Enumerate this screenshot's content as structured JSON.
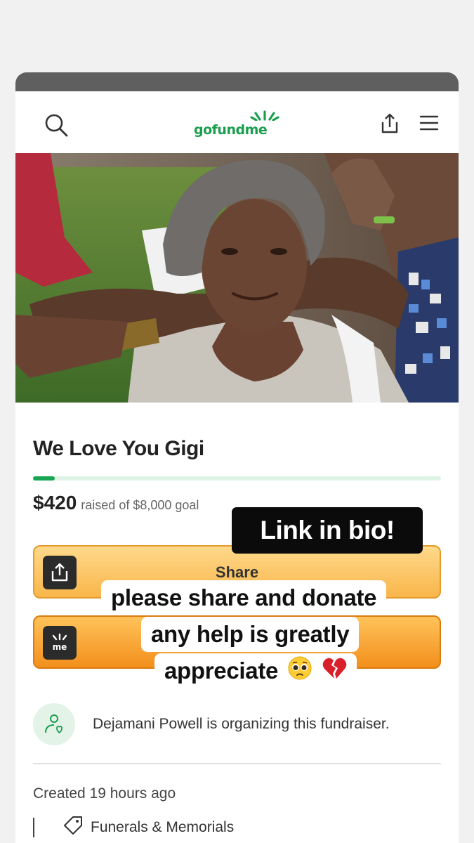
{
  "brand": {
    "logo_text": "gofundme"
  },
  "campaign": {
    "title": "We Love You Gigi",
    "raised_amount": "$420",
    "raised_goal": "raised of $8,000 goal",
    "progress_percent": 5.25
  },
  "buttons": {
    "share_label": "Share",
    "donate_icon_text": "me"
  },
  "organizer": {
    "text": "Dejamani Powell is organizing this fundraiser."
  },
  "meta": {
    "created": "Created 19 hours ago",
    "category": "Funerals & Memorials"
  },
  "overlay": {
    "link_text": "Link in bio!",
    "caption_line1": "please share and donate",
    "caption_line2": "any help is greatly",
    "caption_line3": "appreciate"
  },
  "colors": {
    "brand_green": "#1a9e4e",
    "button_orange": "#f9b64a",
    "overlay_black": "#0b0b0b"
  },
  "icons": [
    "search-icon",
    "share-icon",
    "menu-icon",
    "upload-icon",
    "gofundme-me-icon",
    "organizer-heart-icon",
    "tag-icon",
    "pleading-face-emoji",
    "broken-heart-emoji"
  ]
}
